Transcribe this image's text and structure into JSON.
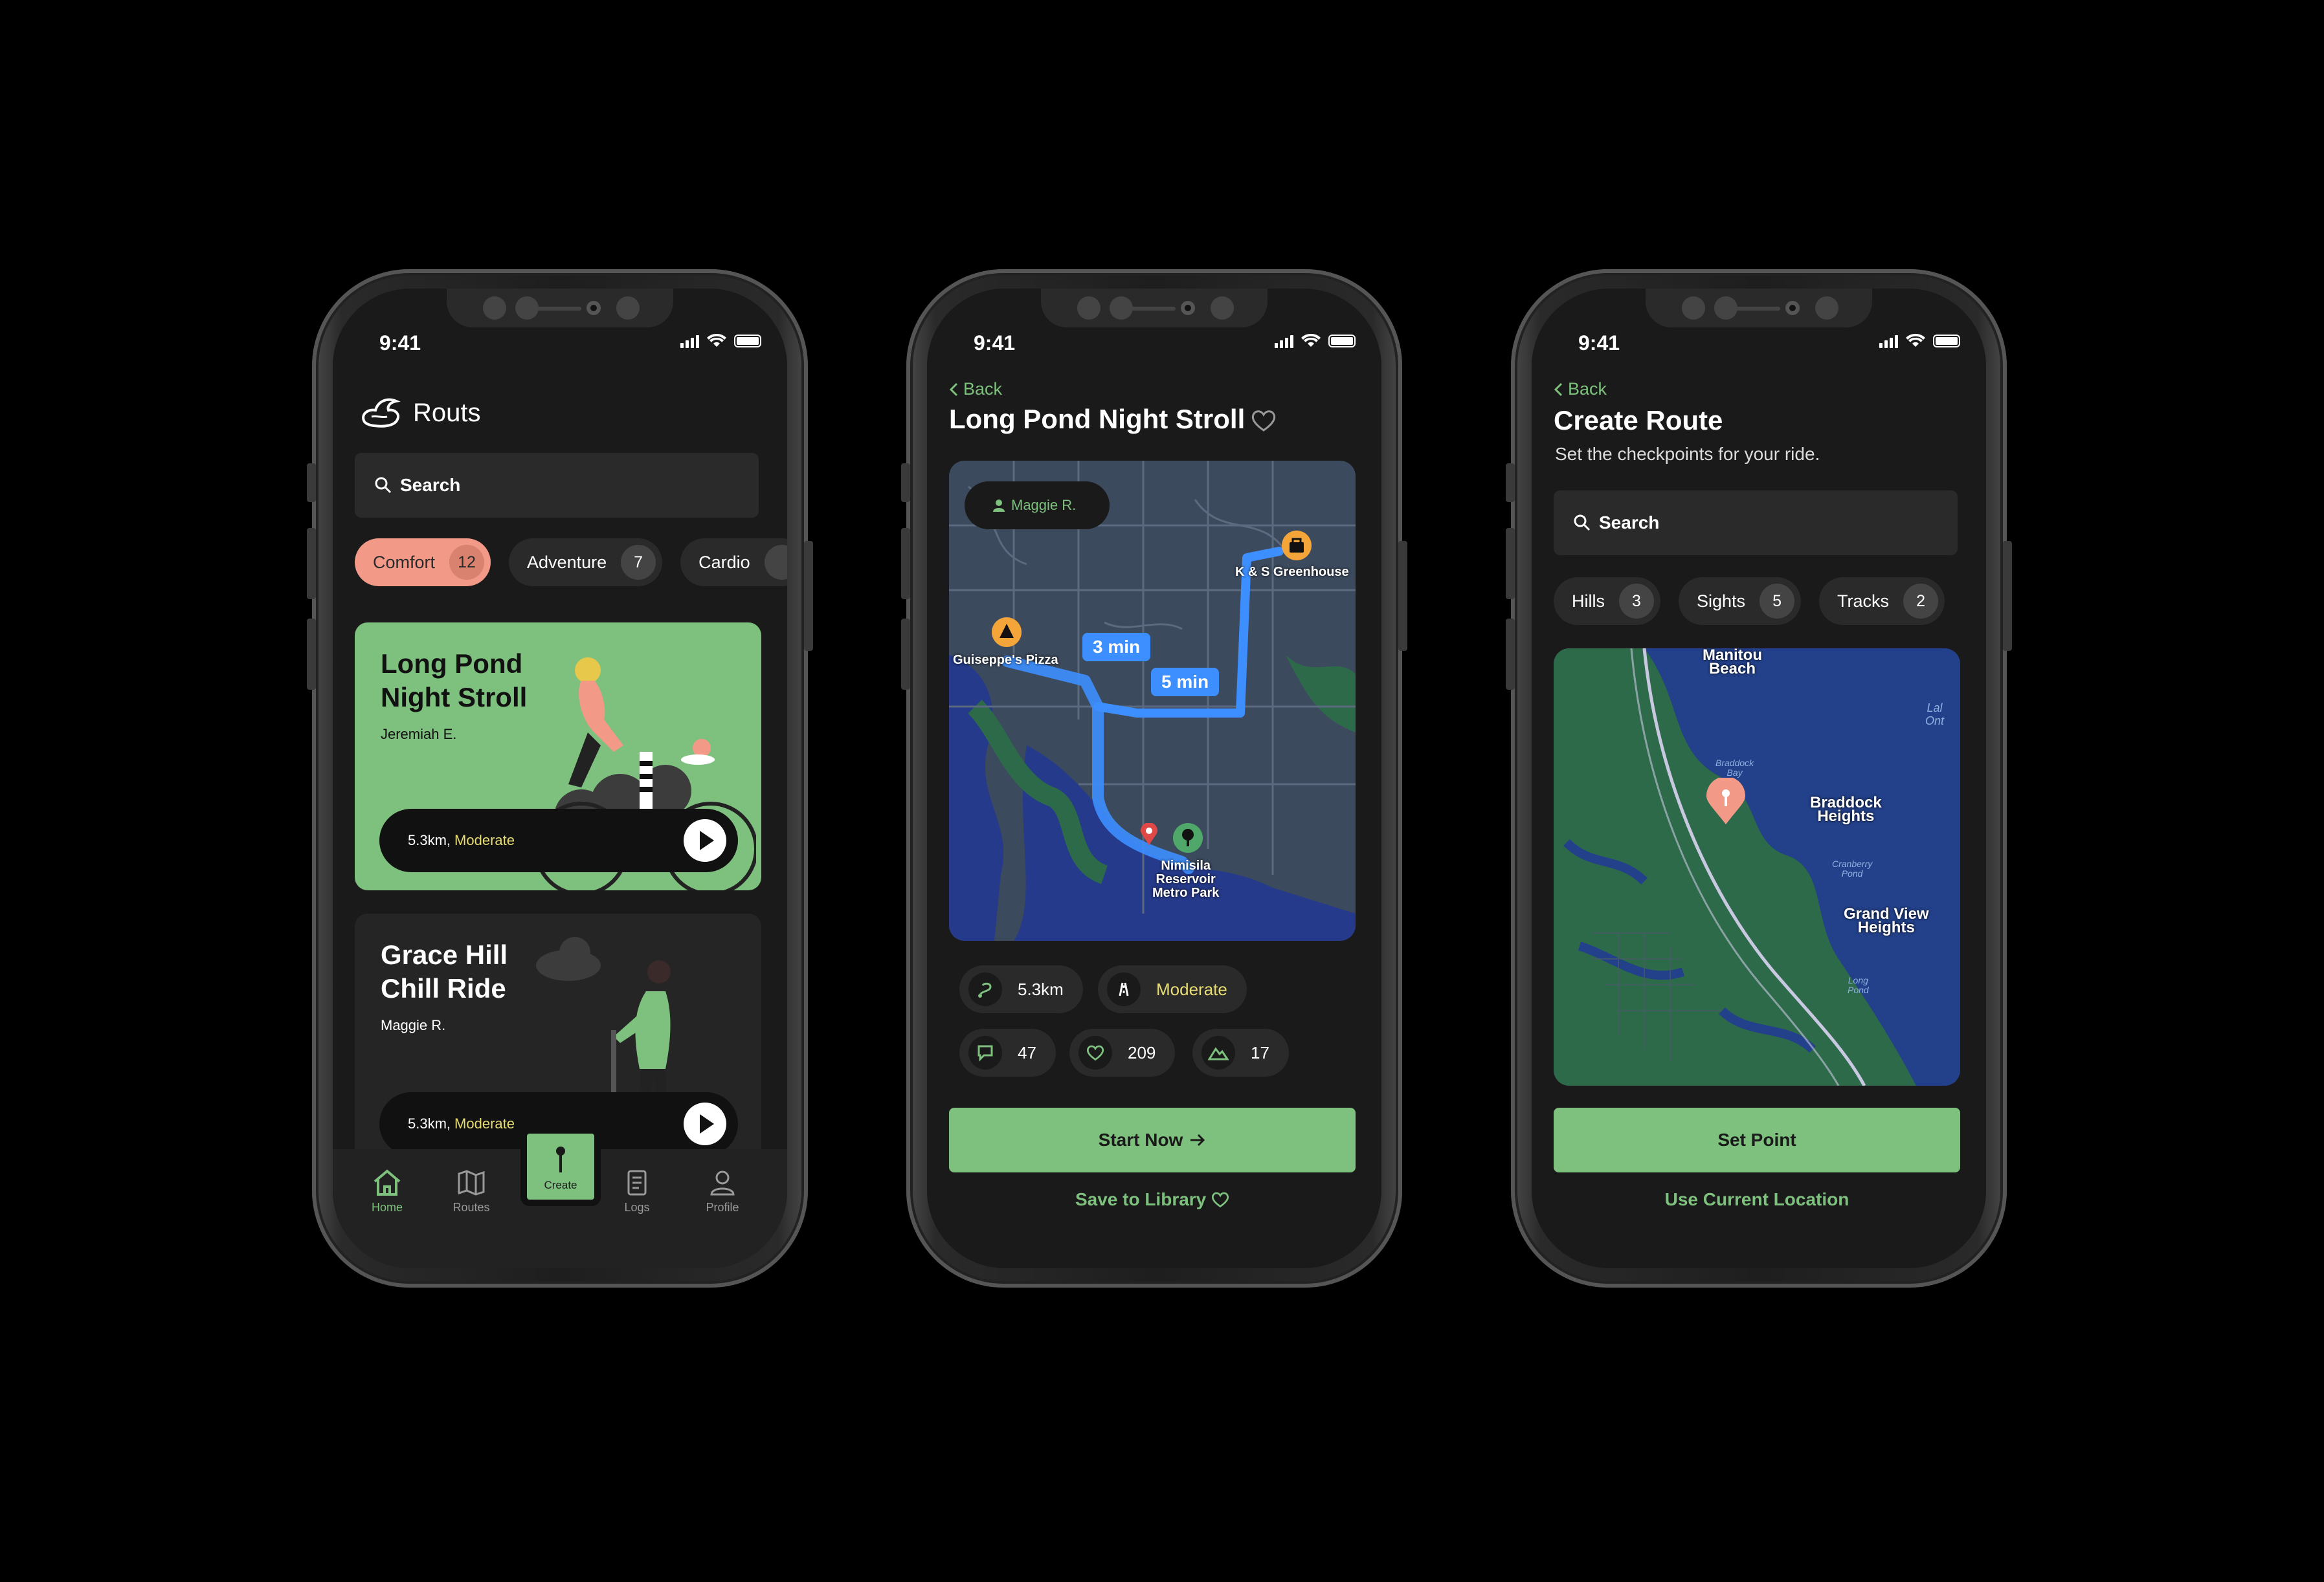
{
  "status": {
    "time": "9:41"
  },
  "screen1": {
    "app_title": "Routs",
    "search_placeholder": "Search",
    "chips": [
      {
        "label": "Comfort",
        "count": "12"
      },
      {
        "label": "Adventure",
        "count": "7"
      },
      {
        "label": "Cardio",
        "count": ""
      }
    ],
    "cards": [
      {
        "title_line1": "Long Pond",
        "title_line2": "Night Stroll",
        "author": "Jeremiah E.",
        "distance": "5.3km,",
        "difficulty": "Moderate"
      },
      {
        "title_line1": "Grace Hill",
        "title_line2": "Chill Ride",
        "author": "Maggie R.",
        "distance": "5.3km,",
        "difficulty": "Moderate"
      }
    ],
    "tabbar": {
      "home": "Home",
      "routes": "Routes",
      "create": "Create",
      "logs": "Logs",
      "profile": "Profile"
    }
  },
  "screen2": {
    "back": "Back",
    "title": "Long Pond Night Stroll",
    "map": {
      "user": "Maggie R.",
      "poi1": "K & S Greenhouse",
      "poi2": "Guiseppe's Pizza",
      "poi3_l1": "Nimisila",
      "poi3_l2": "Reservoir",
      "poi3_l3": "Metro Park",
      "time1": "3 min",
      "time2": "5 min"
    },
    "stats": {
      "distance": "5.3km",
      "difficulty": "Moderate",
      "comments": "47",
      "likes": "209",
      "elevation": "17"
    },
    "start_button": "Start Now",
    "save_link": "Save to Library"
  },
  "screen3": {
    "back": "Back",
    "title": "Create Route",
    "subtitle": "Set the checkpoints for your ride.",
    "search_placeholder": "Search",
    "chips": [
      {
        "label": "Hills",
        "count": "3"
      },
      {
        "label": "Sights",
        "count": "5"
      },
      {
        "label": "Tracks",
        "count": "2"
      }
    ],
    "map": {
      "l1a": "Manitou",
      "l1b": "Beach",
      "l2a": "Braddock",
      "l2b": "Heights",
      "l3a": "Grand View",
      "l3b": "Heights",
      "small1a": "Braddock",
      "small1b": "Bay",
      "small2a": "Cranberry",
      "small2b": "Pond",
      "small3a": "Long",
      "small3b": "Pond",
      "small4a": "Lal",
      "small4b": "Ont"
    },
    "set_point": "Set Point",
    "use_location": "Use Current Location"
  },
  "colors": {
    "accent": "#7ec07e",
    "chip_active": "#f29a87",
    "moderate": "#e8dc74",
    "route": "#3d8fff"
  }
}
